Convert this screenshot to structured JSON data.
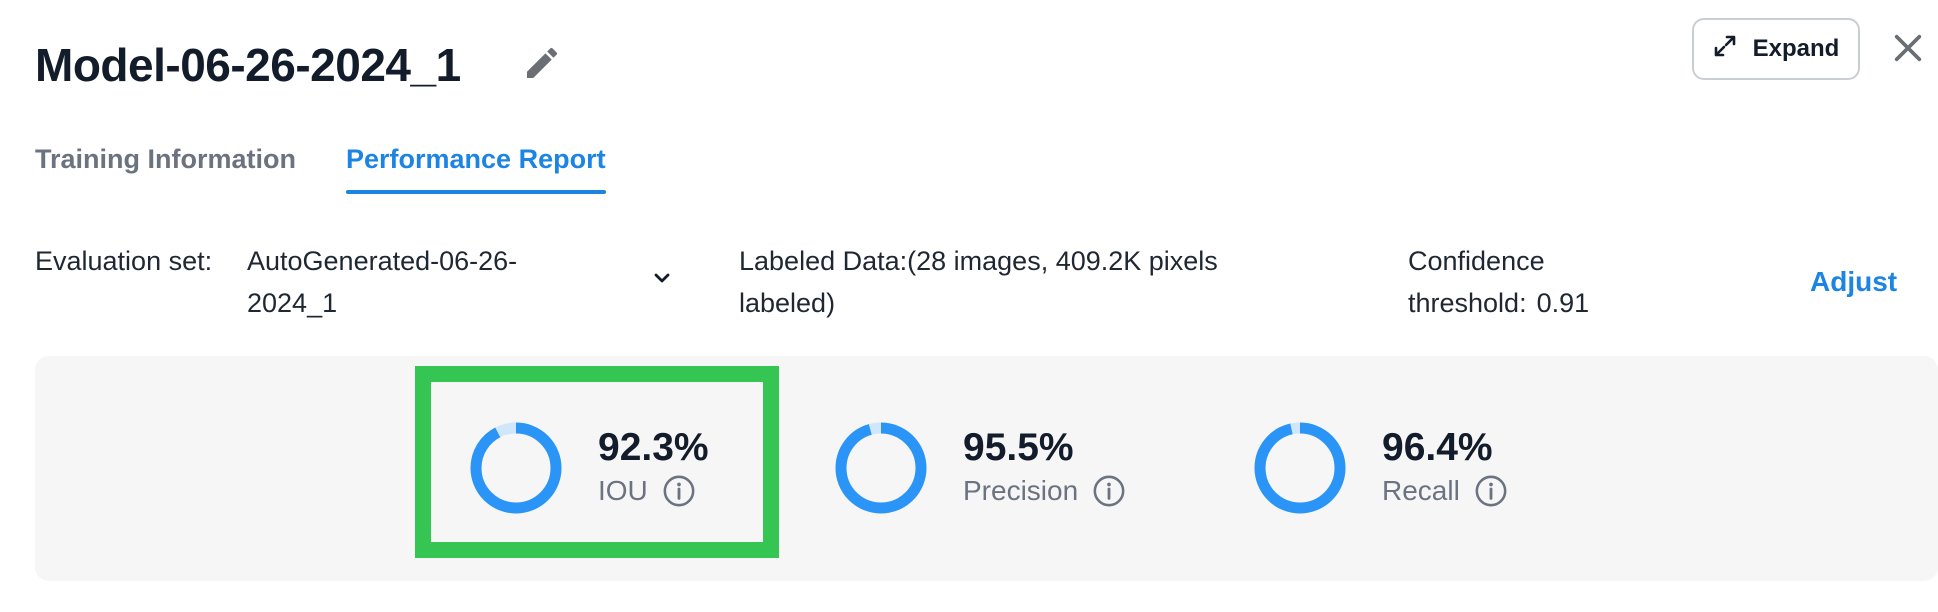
{
  "header": {
    "title": "Model-06-26-2024_1",
    "expand_label": "Expand"
  },
  "icons": {
    "edit": "pencil-icon",
    "expand": "expand-arrows-icon",
    "close": "close-icon",
    "dropdown": "chevron-down-icon",
    "info": "info-icon"
  },
  "tabs": [
    {
      "label": "Training Information",
      "active": false
    },
    {
      "label": "Performance Report",
      "active": true
    }
  ],
  "evaluation": {
    "label": "Evaluation set:",
    "value": "AutoGenerated-06-26-2024_1"
  },
  "labeled_data": "Labeled Data:(28 images, 409.2K pixels labeled)",
  "confidence": {
    "label": "Confidence threshold:",
    "value": "0.91"
  },
  "adjust_label": "Adjust",
  "metrics": [
    {
      "value": "92.3%",
      "label": "IOU",
      "fraction": 0.923,
      "highlighted": true
    },
    {
      "value": "95.5%",
      "label": "Precision",
      "fraction": 0.955,
      "highlighted": false
    },
    {
      "value": "96.4%",
      "label": "Recall",
      "fraction": 0.964,
      "highlighted": false
    }
  ],
  "colors": {
    "accent": "#1c84e3",
    "ring_fill": "#2b95f7",
    "ring_track": "#cfe6fb",
    "highlight": "#34c553",
    "panel_bg": "#f6f6f7"
  }
}
